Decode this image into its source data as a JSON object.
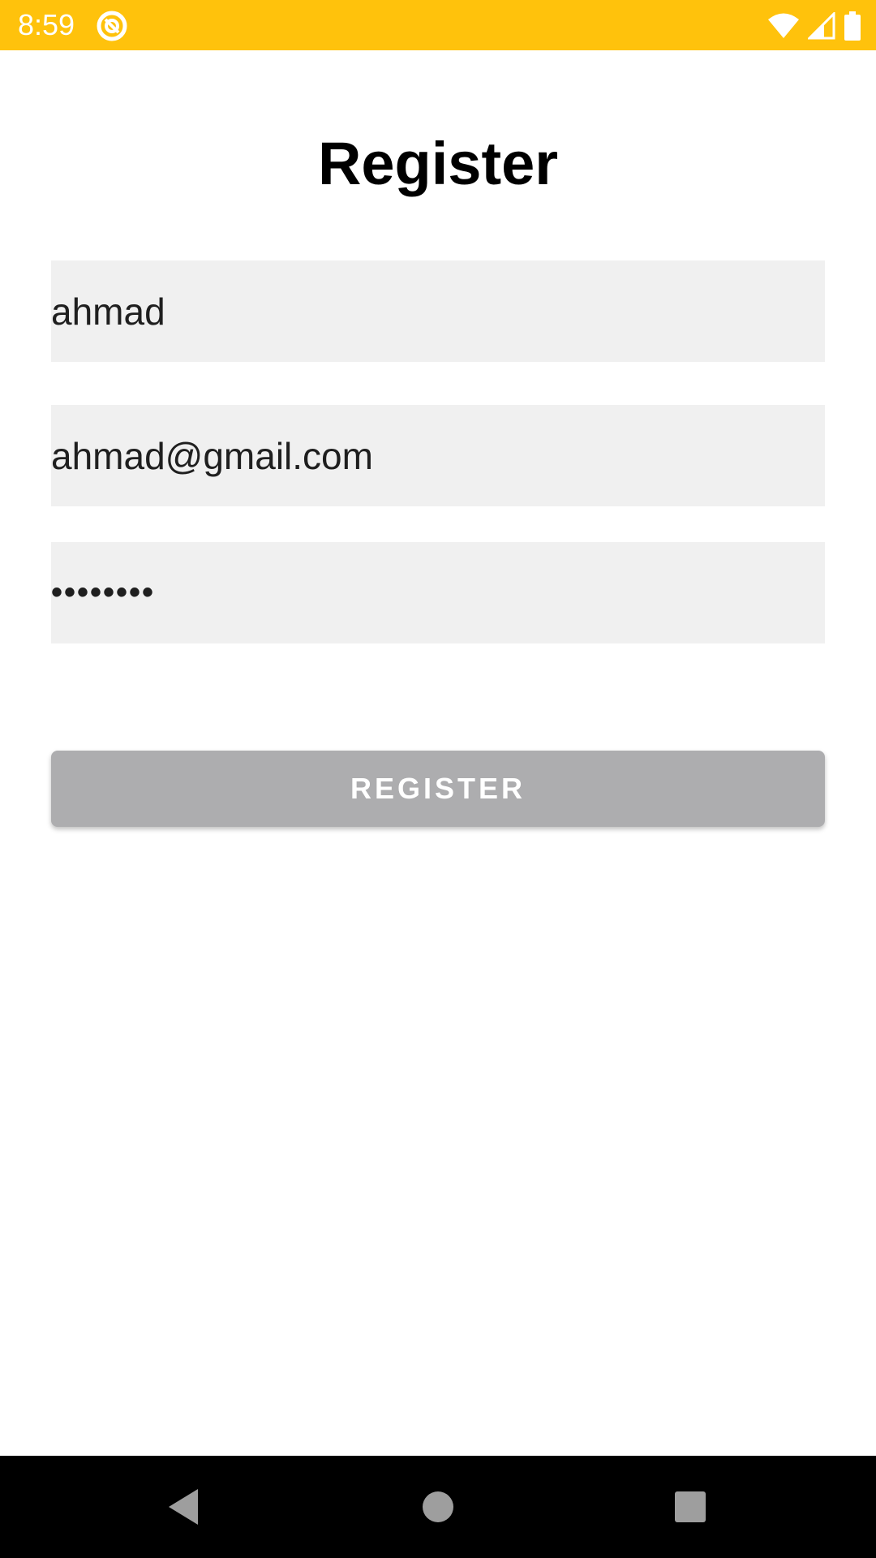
{
  "status_bar": {
    "time": "8:59",
    "app_icon": "notification-app-icon",
    "icons": [
      "wifi-icon",
      "cell-signal-icon",
      "battery-icon"
    ],
    "background_color": "#ffc20c"
  },
  "page": {
    "title": "Register"
  },
  "form": {
    "username_value": "ahmad",
    "email_value": "ahmad@gmail.com",
    "password_value": "••••••••",
    "field_background": "#f0f0f0"
  },
  "button": {
    "label": "REGISTER",
    "background_color": "#adadaf"
  },
  "nav_bar": {
    "icons": [
      "back-icon",
      "home-icon",
      "recents-icon"
    ]
  }
}
